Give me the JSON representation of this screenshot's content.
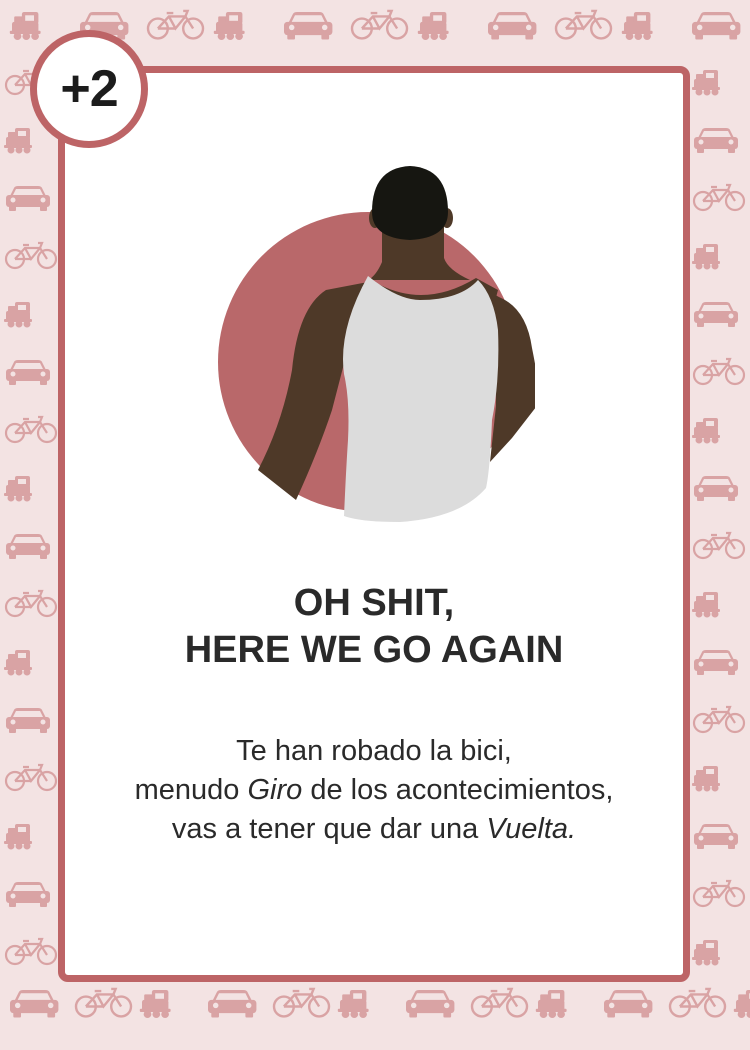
{
  "card": {
    "badge": "+2",
    "title_line1": "OH SHIT,",
    "title_line2": "HERE WE GO AGAIN",
    "text_line1": "Te han robado la bici,",
    "text_line2_a": "menudo ",
    "text_line2_em": "Giro",
    "text_line2_b": " de los acontecimientos,",
    "text_line3_a": "vas a tener que dar una ",
    "text_line3_em": "Vuelta."
  },
  "colors": {
    "border": "#bd6466",
    "pattern_icons": "#d9a3a4",
    "background": "#f3e3e3",
    "card": "#ffffff",
    "circle": "#b9686a",
    "skin": "#4e3928",
    "tank_top": "#dcdcdc",
    "hair": "#161611"
  },
  "icons": [
    "train-icon",
    "car-icon",
    "bicycle-icon"
  ]
}
